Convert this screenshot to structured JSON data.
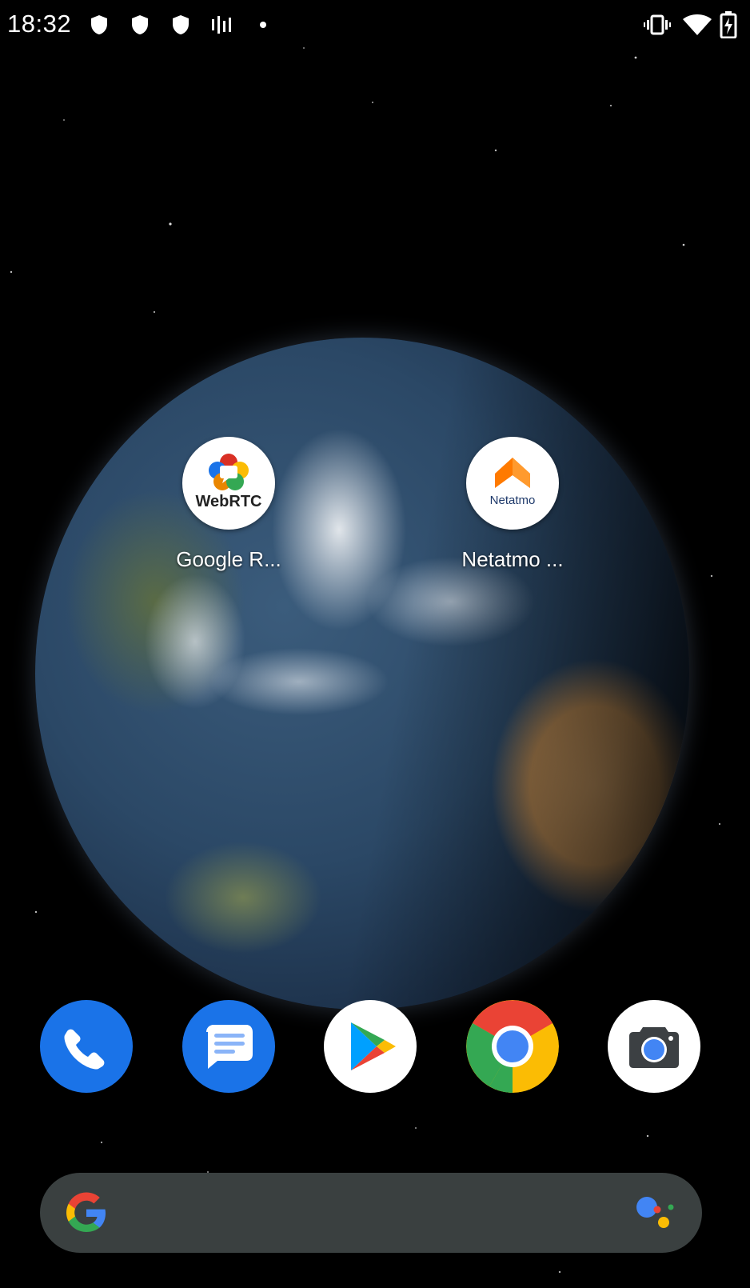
{
  "status_bar": {
    "time": "18:32",
    "left_icons": [
      "shield-icon",
      "shield-icon",
      "shield-icon",
      "signal-bars-icon",
      "dot-icon"
    ],
    "right_icons": [
      "vibrate-icon",
      "wifi-icon",
      "battery-charging-icon"
    ]
  },
  "home": {
    "apps": [
      {
        "label": "Google R...",
        "icon": "webrtc-icon",
        "icon_text": "WebRTC"
      },
      {
        "label": "Netatmo ...",
        "icon": "netatmo-icon",
        "icon_text": "Netatmo",
        "accent": "#ff7a00"
      }
    ]
  },
  "dock": [
    {
      "name": "phone",
      "icon": "phone-icon",
      "color": "#1a73e8"
    },
    {
      "name": "messages",
      "icon": "messages-icon",
      "color": "#1a73e8"
    },
    {
      "name": "play-store",
      "icon": "play-store-icon"
    },
    {
      "name": "chrome",
      "icon": "chrome-icon"
    },
    {
      "name": "camera",
      "icon": "camera-icon"
    }
  ],
  "search": {
    "logo": "google-g-icon",
    "assistant": "google-assistant-icon"
  }
}
